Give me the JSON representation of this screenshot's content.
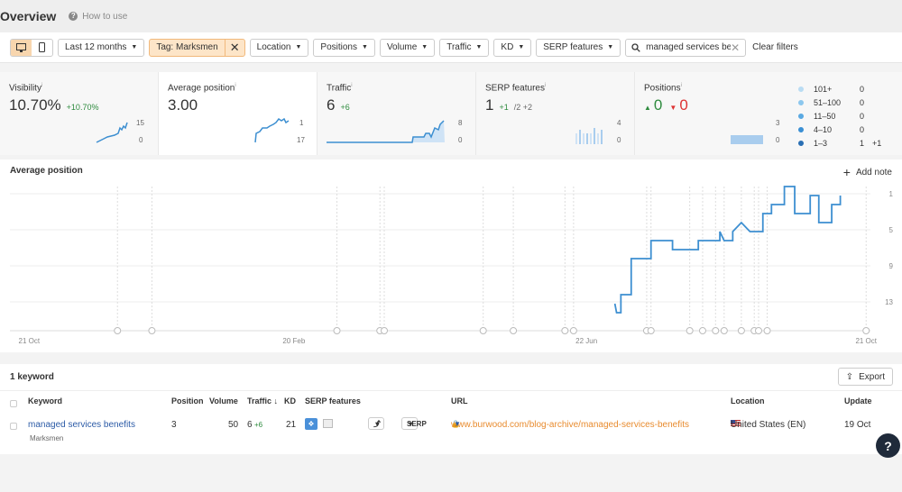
{
  "header": {
    "title": "Overview",
    "how_to_use": "How to use"
  },
  "filters": {
    "period": "Last 12 months",
    "tag": "Tag: Marksmen",
    "location": "Location",
    "positions": "Positions",
    "volume": "Volume",
    "traffic": "Traffic",
    "kd": "KD",
    "serp_features": "SERP features",
    "search_value": "managed services be",
    "clear_filters": "Clear filters"
  },
  "metrics": {
    "visibility": {
      "label": "Visibility",
      "value": "10.70%",
      "delta": "+10.70%",
      "axis_top": "15",
      "axis_bottom": "0"
    },
    "avg_position": {
      "label": "Average position",
      "value": "3.00",
      "axis_top": "1",
      "axis_bottom": "17"
    },
    "traffic": {
      "label": "Traffic",
      "value": "6",
      "delta": "+6",
      "axis_top": "8",
      "axis_bottom": "0"
    },
    "serp": {
      "label": "SERP features",
      "value": "1",
      "delta": "+1",
      "delta2": "/2 +2",
      "axis_top": "4",
      "axis_bottom": "0"
    },
    "positions": {
      "label": "Positions",
      "up": "0",
      "down": "0",
      "axis_top": "3",
      "axis_bottom": "0"
    },
    "legend": [
      {
        "label": "101+",
        "count": "0",
        "change": "",
        "color": "#b9dcf3"
      },
      {
        "label": "51–100",
        "count": "0",
        "change": "",
        "color": "#8cc7ee"
      },
      {
        "label": "11–50",
        "count": "0",
        "change": "",
        "color": "#5aa9e2"
      },
      {
        "label": "4–10",
        "count": "0",
        "change": "",
        "color": "#3a8fd4"
      },
      {
        "label": "1–3",
        "count": "1",
        "change": "+1",
        "color": "#2a6fb4"
      }
    ]
  },
  "chart": {
    "title": "Average position",
    "add_note": "Add note",
    "x_labels": [
      "21 Oct",
      "20 Feb",
      "22 Jun",
      "21 Oct"
    ],
    "y_labels": [
      "1",
      "5",
      "9",
      "13"
    ],
    "color": "#3d8fd1"
  },
  "chart_data": {
    "type": "line",
    "title": "Average position",
    "x_range": [
      "21 Oct",
      "21 Oct"
    ],
    "y_range": [
      1,
      17
    ],
    "y_inverted": true,
    "grid": true,
    "series": [
      {
        "values": [
          [
            0.703,
            14
          ],
          [
            0.705,
            15
          ],
          [
            0.71,
            15
          ],
          [
            0.71,
            13
          ],
          [
            0.722,
            13
          ],
          [
            0.722,
            9
          ],
          [
            0.745,
            9
          ],
          [
            0.745,
            7
          ],
          [
            0.77,
            7
          ],
          [
            0.77,
            8
          ],
          [
            0.8,
            8
          ],
          [
            0.8,
            7
          ],
          [
            0.825,
            7
          ],
          [
            0.825,
            6
          ],
          [
            0.83,
            7
          ],
          [
            0.84,
            7
          ],
          [
            0.84,
            6
          ],
          [
            0.85,
            5
          ],
          [
            0.86,
            6
          ],
          [
            0.875,
            6
          ],
          [
            0.875,
            4
          ],
          [
            0.885,
            4
          ],
          [
            0.885,
            3
          ],
          [
            0.9,
            3
          ],
          [
            0.9,
            1
          ],
          [
            0.912,
            1
          ],
          [
            0.912,
            4
          ],
          [
            0.93,
            4
          ],
          [
            0.93,
            2
          ],
          [
            0.94,
            2
          ],
          [
            0.94,
            5
          ],
          [
            0.955,
            5
          ],
          [
            0.955,
            3
          ],
          [
            0.965,
            3
          ],
          [
            0.965,
            2
          ]
        ]
      }
    ]
  },
  "keywords": {
    "count_label": "1 keyword",
    "export": "Export",
    "columns": [
      "Keyword",
      "Position",
      "Volume",
      "Traffic ↓",
      "KD",
      "SERP features",
      "URL",
      "Location",
      "Update"
    ],
    "rows": [
      {
        "keyword": "managed services benefits",
        "tag": "Marksmen",
        "position": "3",
        "volume": "50",
        "traffic": "6",
        "traffic_delta": "+6",
        "kd": "21",
        "serp_btn": "SERP",
        "url": "www.burwood.com/blog-archive/managed-services-benefits",
        "location": "United States (EN)",
        "update": "19 Oct"
      }
    ]
  },
  "help_label": "?"
}
